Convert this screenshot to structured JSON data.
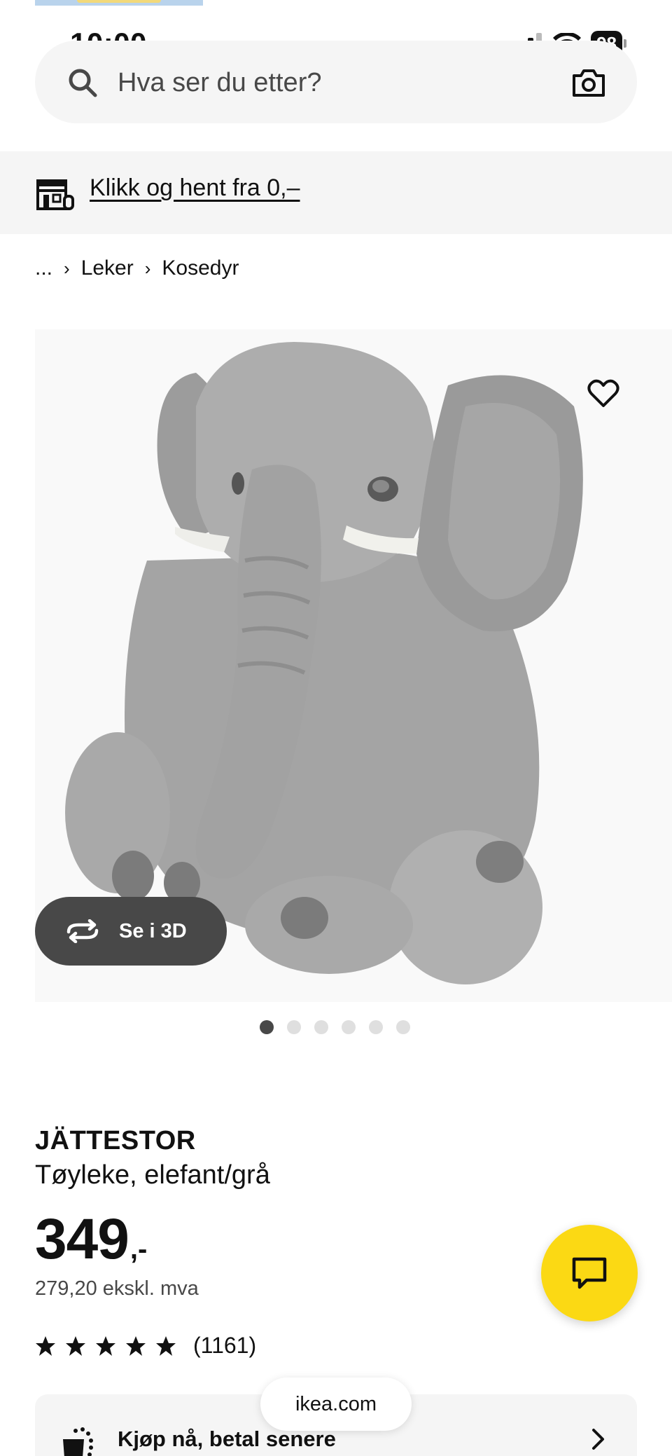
{
  "status_bar": {
    "time": "10:00",
    "battery": "98"
  },
  "search": {
    "placeholder": "Hva ser du etter?"
  },
  "promo": {
    "link_text": "Klikk og hent fra 0,–"
  },
  "breadcrumb": {
    "ellipsis": "...",
    "items": [
      "Leker",
      "Kosedyr"
    ]
  },
  "gallery": {
    "view_3d_label": "Se i 3D",
    "image_count": 6,
    "active_index": 0
  },
  "product": {
    "name": "JÄTTESTOR",
    "description": "Tøyleke, elefant/grå",
    "price": "349",
    "price_suffix": ",-",
    "price_ex_vat": "279,20 ekskl. mva",
    "rating_stars": 5,
    "review_count": "(1161)"
  },
  "payment": {
    "label": "Kjøp nå, betal senere"
  },
  "browser": {
    "domain": "ikea.com"
  },
  "colors": {
    "accent_yellow": "#fbd914",
    "dark_button": "#484848",
    "banner_bg": "#f5f5f5"
  }
}
